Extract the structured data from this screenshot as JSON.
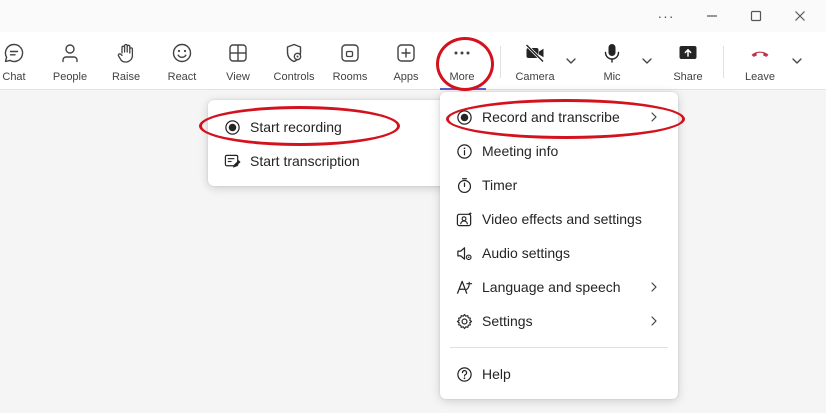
{
  "titlebar": {
    "more_glyph": "···"
  },
  "toolbar": {
    "chat": "Chat",
    "people": "People",
    "raise": "Raise",
    "react": "React",
    "view": "View",
    "controls": "Controls",
    "rooms": "Rooms",
    "apps": "Apps",
    "more": "More",
    "camera": "Camera",
    "mic": "Mic",
    "share": "Share",
    "leave": "Leave"
  },
  "more_menu": {
    "items": [
      {
        "label": "Record and transcribe",
        "icon": "record-icon",
        "has_submenu": true
      },
      {
        "label": "Meeting info",
        "icon": "info-icon",
        "has_submenu": false
      },
      {
        "label": "Timer",
        "icon": "timer-icon",
        "has_submenu": false
      },
      {
        "label": "Video effects and settings",
        "icon": "video-effects-icon",
        "has_submenu": false
      },
      {
        "label": "Audio settings",
        "icon": "speaker-icon",
        "has_submenu": false
      },
      {
        "label": "Language and speech",
        "icon": "language-icon",
        "has_submenu": true
      },
      {
        "label": "Settings",
        "icon": "gear-icon",
        "has_submenu": true
      },
      {
        "label": "Help",
        "icon": "help-icon",
        "has_submenu": false
      }
    ]
  },
  "record_submenu": {
    "items": [
      {
        "label": "Start recording",
        "icon": "record-icon"
      },
      {
        "label": "Start transcription",
        "icon": "transcription-icon"
      }
    ]
  },
  "colors": {
    "annotation": "#d3121d",
    "accent": "#5b5fc7",
    "leave": "#c4314b"
  }
}
